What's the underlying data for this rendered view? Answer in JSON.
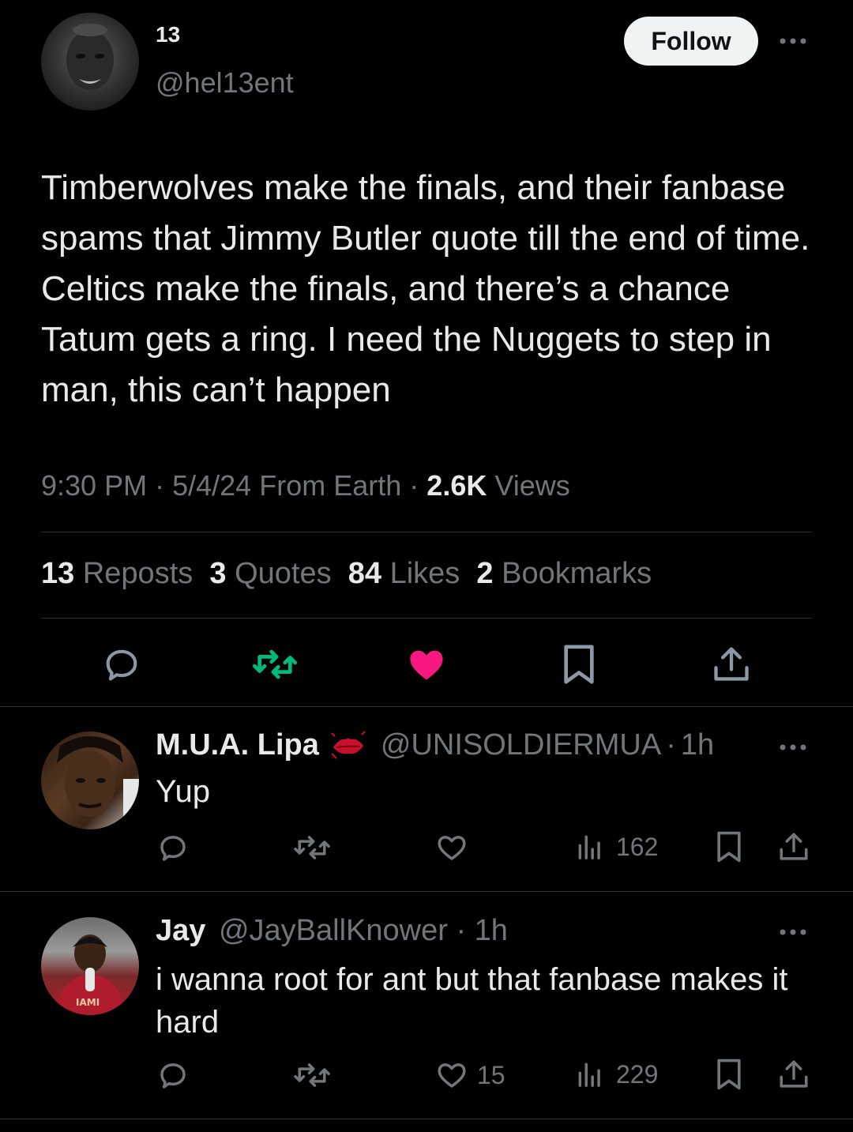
{
  "tweet": {
    "display_name": "13",
    "handle": "@hel13ent",
    "follow_label": "Follow",
    "text": "Timberwolves make the finals, and their fanbase spams that Jimmy Butler quote till the end of time. Celtics make the finals, and there’s a chance Tatum gets a ring. I need the Nuggets to step in man, this can’t happen",
    "time": "9:30 PM",
    "date": "5/4/24",
    "source": "From Earth",
    "views_count": "2.6K",
    "views_label": "Views",
    "reposts_count": "13",
    "reposts_label": "Reposts",
    "quotes_count": "3",
    "quotes_label": "Quotes",
    "likes_count": "84",
    "likes_label": "Likes",
    "bookmarks_count": "2",
    "bookmarks_label": "Bookmarks",
    "action_icons": [
      "reply-icon",
      "repost-icon",
      "like-icon",
      "bookmark-icon",
      "share-icon"
    ],
    "colors": {
      "repost_active": "#00ba7c",
      "like_active": "#f91880"
    }
  },
  "replies": [
    {
      "display_name": "M.U.A. Lipa",
      "badge_icon": "lips-emoji-icon",
      "handle": "@UNISOLDIERMUA",
      "time": "1h",
      "text": "Yup",
      "likes": "",
      "views": "162"
    },
    {
      "display_name": "Jay",
      "handle": "@JayBallKnower",
      "time": "1h",
      "text": "i wanna root for ant but that fanbase makes it hard",
      "likes": "15",
      "views": "229"
    }
  ],
  "separator": "·"
}
